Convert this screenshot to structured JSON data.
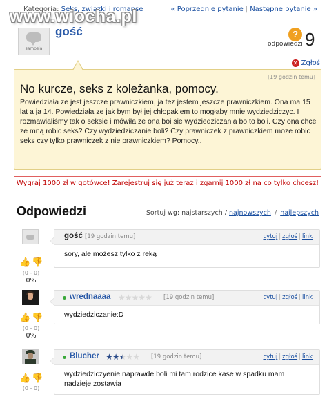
{
  "watermark": "www.wiocha.pl",
  "topbar": {
    "category_prefix": "Kategoria:",
    "category_link": "Seks, związki i romanse",
    "prev": "« Poprzednie pytanie",
    "next": "Następne pytanie »"
  },
  "question": {
    "author": "gość",
    "avatar_brand": "samosia",
    "answers_count": "9",
    "answers_label": "odpowiedzi",
    "report": "Zgłoś",
    "time": "[19 godzin temu]",
    "title": "No kurcze, seks z koleżanka, pomocy.",
    "body": "Powiedziała ze jest jeszcze prawniczkiem, ja tez jestem jeszcze prawniczkiem. Ona ma 15 lat a ja 14. Powiedziała ze jak bym był jej chłopakiem to mogłaby mnie wydziedziczyc. I rozmawialiśmy tak o seksie i mówiła ze ona boi sie wydziedziczania bo to boli. Czy ona chce ze mną robic seks? Czy wydziedziczanie boli? Czy prawniczek z prawniczkiem moze robic seks czy tylko prawniczek z nie prawniczkiem? Pomocy.."
  },
  "ad": {
    "text": "Wygraj 1000 zł w gotówce! Zarejestruj się już teraz i zgarnij 1000 zł na co tylko chcesz!"
  },
  "answers_header": {
    "title": "Odpowiedzi",
    "sort_label": "Sortuj wg: najstarszych /",
    "sort_newest": "najnowszych",
    "sort_sep": "/",
    "sort_best": "najlepszych"
  },
  "answers": [
    {
      "author": "gość",
      "time": "[19 godzin temu]",
      "body": "sory, ale możesz tylko z reką",
      "score": "(0 - 0)",
      "percent": "0%",
      "rating": 0,
      "actions": [
        "cytuj",
        "zgłoś",
        "link"
      ]
    },
    {
      "author": "wrednaaaa",
      "time": "[19 godzin temu]",
      "body": "wydziedziczanie:D",
      "score": "(0 - 0)",
      "percent": "0%",
      "rating": 0,
      "actions": [
        "cytuj",
        "zgłoś",
        "link"
      ]
    },
    {
      "author": "Blucher",
      "time": "[19 godzin temu]",
      "body": "wydziedziczyenie naprawde boli mi tam rodzice kase w spadku mam nadzieje zostawia",
      "score": "(0 - 0)",
      "percent": "",
      "rating": 2.5,
      "actions": [
        "cytuj",
        "zgłoś",
        "link"
      ]
    }
  ],
  "icons": {
    "question": "question-mark-icon",
    "report": "x-circle-icon",
    "thumb_up": "thumb-up-icon",
    "thumb_down": "thumb-down-icon",
    "online": "online-dot-icon",
    "star": "star-icon"
  },
  "colors": {
    "link": "#1a4fa0",
    "question_bg": "#fdf5d6",
    "ad_border": "#e06060",
    "author_blue": "#2a5aa8",
    "thumb_up": "#e8358c",
    "thumb_down": "#e8a020"
  }
}
